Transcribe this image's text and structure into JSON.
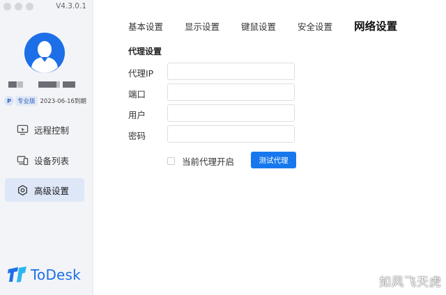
{
  "app": {
    "version": "V4.3.0.1"
  },
  "account": {
    "edition_badge": "P",
    "edition_label": "专业版",
    "expiry": "2023-06-16到期"
  },
  "sidebar": {
    "items": [
      {
        "label": "远程控制",
        "icon": "remote-control-icon"
      },
      {
        "label": "设备列表",
        "icon": "device-list-icon"
      },
      {
        "label": "高级设置",
        "icon": "settings-gear-icon"
      }
    ],
    "active_index": 2
  },
  "logo": {
    "text": "ToDesk"
  },
  "tabs": [
    {
      "label": "基本设置"
    },
    {
      "label": "显示设置"
    },
    {
      "label": "键鼠设置"
    },
    {
      "label": "安全设置"
    },
    {
      "label": "网络设置"
    }
  ],
  "active_tab": "网络设置",
  "proxy": {
    "section_title": "代理设置",
    "fields": [
      {
        "label": "代理IP",
        "value": ""
      },
      {
        "label": "端口",
        "value": ""
      },
      {
        "label": "用户",
        "value": ""
      },
      {
        "label": "密码",
        "value": ""
      }
    ],
    "enable_label": "当前代理开启",
    "enabled": false,
    "test_button": "测试代理"
  },
  "watermark": "如风飞天虎",
  "colors": {
    "accent": "#1778ee",
    "sidebar_bg": "#f3f4f7",
    "active_nav_bg": "#dde7f7",
    "logo_blue": "#1d6fe8"
  }
}
